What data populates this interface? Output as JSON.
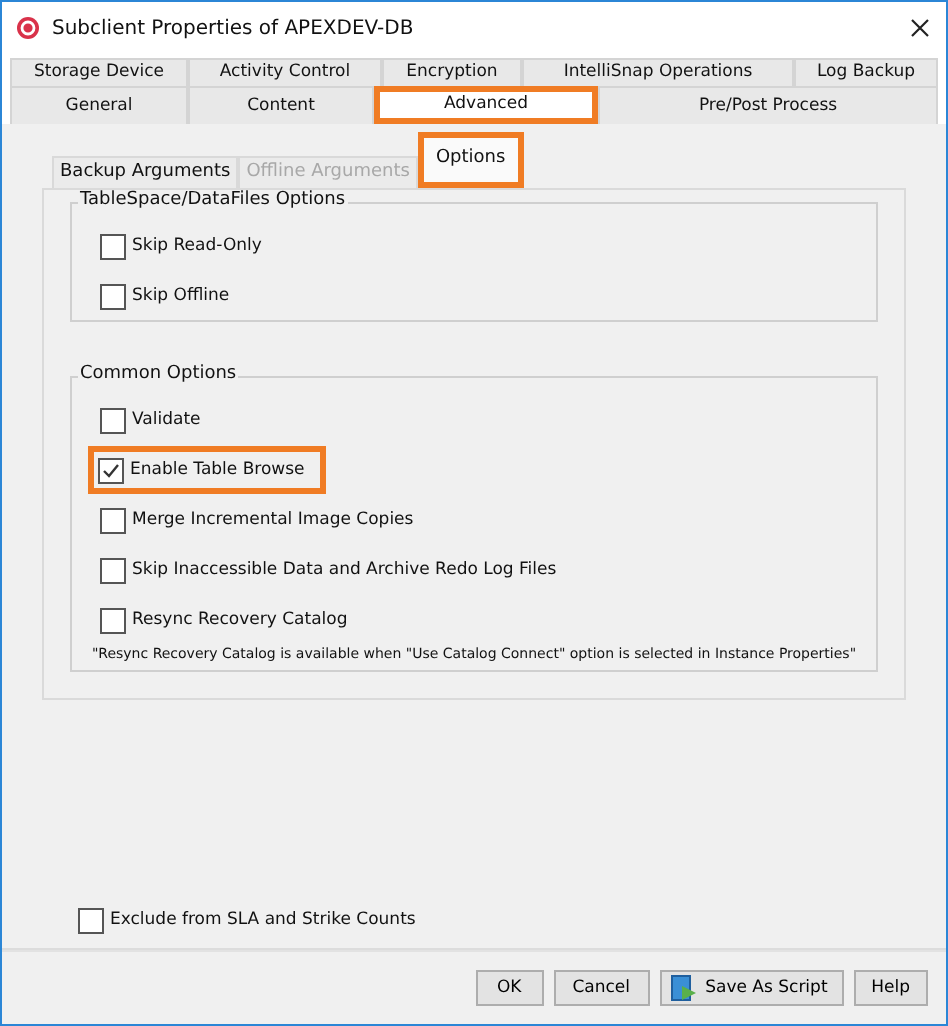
{
  "window": {
    "title": "Subclient Properties of APEXDEV-DB"
  },
  "tab_rows": [
    [
      {
        "label": "Storage Device",
        "selected": false,
        "highlighted": false
      },
      {
        "label": "Activity Control",
        "selected": false,
        "highlighted": false
      },
      {
        "label": "Encryption",
        "selected": false,
        "highlighted": false
      },
      {
        "label": "IntelliSnap Operations",
        "selected": false,
        "highlighted": false
      },
      {
        "label": "Log Backup",
        "selected": false,
        "highlighted": false
      }
    ],
    [
      {
        "label": "General",
        "selected": false,
        "highlighted": false
      },
      {
        "label": "Content",
        "selected": false,
        "highlighted": false
      },
      {
        "label": "Advanced",
        "selected": true,
        "highlighted": true
      },
      {
        "label": "Pre/Post Process",
        "selected": false,
        "highlighted": false
      }
    ]
  ],
  "subtabs": [
    {
      "label": "Backup Arguments",
      "selected": false,
      "disabled": false,
      "highlighted": false
    },
    {
      "label": "Offline Arguments",
      "selected": false,
      "disabled": true,
      "highlighted": false
    },
    {
      "label": "Options",
      "selected": true,
      "disabled": false,
      "highlighted": true
    }
  ],
  "groups": [
    {
      "title": "TableSpace/DataFiles Options",
      "options": [
        {
          "label": "Skip Read-Only",
          "checked": false,
          "highlighted": false
        },
        {
          "label": "Skip Offline",
          "checked": false,
          "highlighted": false
        }
      ]
    },
    {
      "title": "Common Options",
      "options": [
        {
          "label": "Validate",
          "checked": false,
          "highlighted": false
        },
        {
          "label": "Enable Table Browse",
          "checked": true,
          "highlighted": true
        },
        {
          "label": "Merge Incremental Image Copies",
          "checked": false,
          "highlighted": false
        },
        {
          "label": "Skip Inaccessible Data and Archive Redo Log Files",
          "checked": false,
          "highlighted": false
        },
        {
          "label": "Resync Recovery Catalog",
          "checked": false,
          "highlighted": false
        }
      ],
      "note": "\"Resync Recovery Catalog is available when \"Use Catalog Connect\" option is selected in Instance Properties\""
    }
  ],
  "exclude_option": {
    "label": "Exclude from SLA and Strike Counts",
    "checked": false
  },
  "buttons": [
    {
      "label": "OK",
      "kind": "plain"
    },
    {
      "label": "Cancel",
      "kind": "plain"
    },
    {
      "label": "Save As Script",
      "kind": "script"
    },
    {
      "label": "Help",
      "kind": "plain"
    }
  ]
}
